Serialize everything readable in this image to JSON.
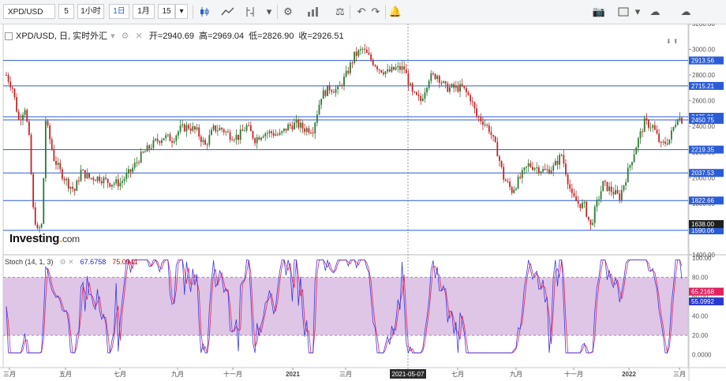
{
  "toolbar": {
    "symbol": "XPD/USD",
    "interval_value": "5",
    "interval_unit": "1小时",
    "range_1d": "1日",
    "range_1m": "1月",
    "number": "15",
    "icons": [
      "candlestick-icon",
      "line-chart-icon",
      "indicator-icon",
      "settings-icon",
      "bar-volume-icon",
      "balance-icon",
      "undo-icon",
      "redo-icon",
      "alert-icon",
      "camera-icon",
      "layout-icon",
      "cloud-download-icon",
      "cloud-upload-icon"
    ]
  },
  "legend": {
    "symbol_title": "XPD/USD, 日, 实时外汇",
    "open_label": "开=",
    "open": "2940.69",
    "high_label": "高=",
    "high": "2969.04",
    "low_label": "低=",
    "low": "2826.90",
    "close_label": "收=",
    "close": "2926.51"
  },
  "stoch_legend": {
    "name": "Stoch (14, 1, 3)",
    "k": "67.6758",
    "d": "75.0941"
  },
  "logo": {
    "text": "Investing",
    "suffix": "com"
  },
  "colors": {
    "up": "#2e7d32",
    "down": "#c62828",
    "hline": "#2a5cd6",
    "stoch_k": "#3a3ae0",
    "stoch_d": "#e0245e",
    "stoch_band": "#dcbfe3",
    "current_price": "#1f1f1f"
  },
  "chart_data": [
    {
      "type": "candlestick",
      "title": "XPD/USD, 日, 实时外汇",
      "ylim": [
        1400,
        3200
      ],
      "y_ticks": [
        "3200.00",
        "3000.00",
        "2800.00",
        "2600.00",
        "2400.00",
        "2200.00",
        "2000.00",
        "1800.00",
        "1600.00",
        "1400.00"
      ],
      "x_ticks": [
        "三月",
        "五月",
        "七月",
        "九月",
        "十一月",
        "2021",
        "三月",
        "2021-05-07",
        "七月",
        "九月",
        "十一月",
        "2022",
        "三月"
      ],
      "highlighted_x": "2021-05-07",
      "horizontal_levels": [
        {
          "label": "2913.56",
          "value": 2913.56
        },
        {
          "label": "2715.21",
          "value": 2715.21
        },
        {
          "label": "2475.01",
          "value": 2475.01
        },
        {
          "label": "2450.75",
          "value": 2450.75
        },
        {
          "label": "2219.35",
          "value": 2219.35
        },
        {
          "label": "2037.53",
          "value": 2037.53
        },
        {
          "label": "1822.66",
          "value": 1822.66
        },
        {
          "label": "1590.06",
          "value": 1590.06
        }
      ],
      "current_price_label": "1638.00",
      "price_path": [
        [
          0,
          2800
        ],
        [
          3,
          2700
        ],
        [
          6,
          2450
        ],
        [
          9,
          2550
        ],
        [
          11,
          2300
        ],
        [
          13,
          1750
        ],
        [
          15,
          1580
        ],
        [
          17,
          1630
        ],
        [
          18,
          2000
        ],
        [
          19,
          2450
        ],
        [
          21,
          2300
        ],
        [
          23,
          2150
        ],
        [
          26,
          2050
        ],
        [
          30,
          1950
        ],
        [
          33,
          1900
        ],
        [
          36,
          2050
        ],
        [
          40,
          2000
        ],
        [
          45,
          2000
        ],
        [
          50,
          1960
        ],
        [
          55,
          1960
        ],
        [
          60,
          2050
        ],
        [
          64,
          2150
        ],
        [
          68,
          2220
        ],
        [
          72,
          2280
        ],
        [
          76,
          2320
        ],
        [
          80,
          2300
        ],
        [
          84,
          2380
        ],
        [
          88,
          2400
        ],
        [
          92,
          2360
        ],
        [
          96,
          2250
        ],
        [
          100,
          2380
        ],
        [
          104,
          2380
        ],
        [
          108,
          2330
        ],
        [
          112,
          2320
        ],
        [
          116,
          2400
        ],
        [
          120,
          2300
        ],
        [
          124,
          2350
        ],
        [
          128,
          2350
        ],
        [
          132,
          2330
        ],
        [
          136,
          2400
        ],
        [
          140,
          2420
        ],
        [
          144,
          2380
        ],
        [
          148,
          2380
        ],
        [
          152,
          2640
        ],
        [
          156,
          2700
        ],
        [
          160,
          2680
        ],
        [
          164,
          2800
        ],
        [
          168,
          2950
        ],
        [
          172,
          3000
        ],
        [
          176,
          2920
        ],
        [
          180,
          2850
        ],
        [
          184,
          2820
        ],
        [
          188,
          2850
        ],
        [
          192,
          2850
        ],
        [
          196,
          2650
        ],
        [
          200,
          2600
        ],
        [
          204,
          2780
        ],
        [
          208,
          2800
        ],
        [
          212,
          2700
        ],
        [
          216,
          2700
        ],
        [
          220,
          2700
        ],
        [
          224,
          2620
        ],
        [
          227,
          2480
        ],
        [
          230,
          2440
        ],
        [
          233,
          2380
        ],
        [
          237,
          2200
        ],
        [
          240,
          2000
        ],
        [
          244,
          1900
        ],
        [
          248,
          2000
        ],
        [
          252,
          2100
        ],
        [
          256,
          2080
        ],
        [
          260,
          2050
        ],
        [
          264,
          2080
        ],
        [
          268,
          2180
        ],
        [
          270,
          2050
        ],
        [
          273,
          1850
        ],
        [
          276,
          1800
        ],
        [
          279,
          1780
        ],
        [
          282,
          1620
        ],
        [
          285,
          1800
        ],
        [
          288,
          1950
        ],
        [
          292,
          1900
        ],
        [
          296,
          1850
        ],
        [
          300,
          2050
        ],
        [
          304,
          2250
        ],
        [
          308,
          2430
        ],
        [
          312,
          2400
        ],
        [
          316,
          2250
        ],
        [
          320,
          2300
        ],
        [
          324,
          2480
        ],
        [
          326,
          2450
        ]
      ],
      "stoch_ylim": [
        -10,
        100
      ],
      "stoch_ticks": [
        "100.00",
        "80.00",
        "60.00",
        "40.00",
        "20.00",
        "0.0000"
      ],
      "stoch_band": [
        20,
        80
      ],
      "stoch_k_last": 65.2168,
      "stoch_d_last": 55.0992,
      "stoch_k_label": "65.2168",
      "stoch_d_label": "55.0992"
    }
  ]
}
